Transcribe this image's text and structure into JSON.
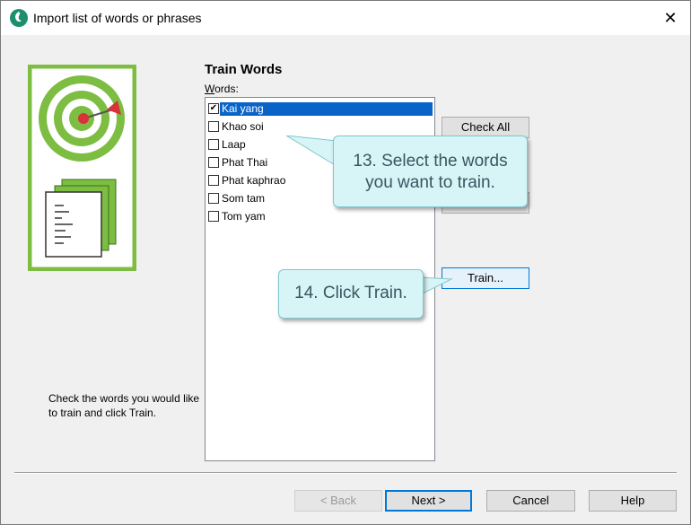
{
  "window": {
    "title": "Import list of words or phrases"
  },
  "main": {
    "heading": "Train Words",
    "words_label_prefix": "W",
    "words_label_rest": "ords:",
    "words": [
      {
        "label": "Kai yang",
        "checked": true,
        "selected": true
      },
      {
        "label": "Khao soi",
        "checked": false,
        "selected": false
      },
      {
        "label": "Laap",
        "checked": false,
        "selected": false
      },
      {
        "label": "Phat Thai",
        "checked": false,
        "selected": false
      },
      {
        "label": "Phat kaphrao",
        "checked": false,
        "selected": false
      },
      {
        "label": "Som tam",
        "checked": false,
        "selected": false
      },
      {
        "label": "Tom yam",
        "checked": false,
        "selected": false
      }
    ],
    "check_all_label": "Check All",
    "train_label": "Train..."
  },
  "callouts": {
    "select_words": "13. Select the words you want to train.",
    "click_train": "14. Click Train."
  },
  "description": "Check the words you would like to train and click Train.",
  "footer": {
    "back_label": "< Back",
    "next_label": "Next >",
    "cancel_label": "Cancel",
    "help_label": "Help"
  },
  "colors": {
    "art_green": "#7cbd42",
    "selection_blue": "#0a64c8",
    "callout_bg": "#d7f5f7",
    "callout_text": "#3b5560"
  }
}
